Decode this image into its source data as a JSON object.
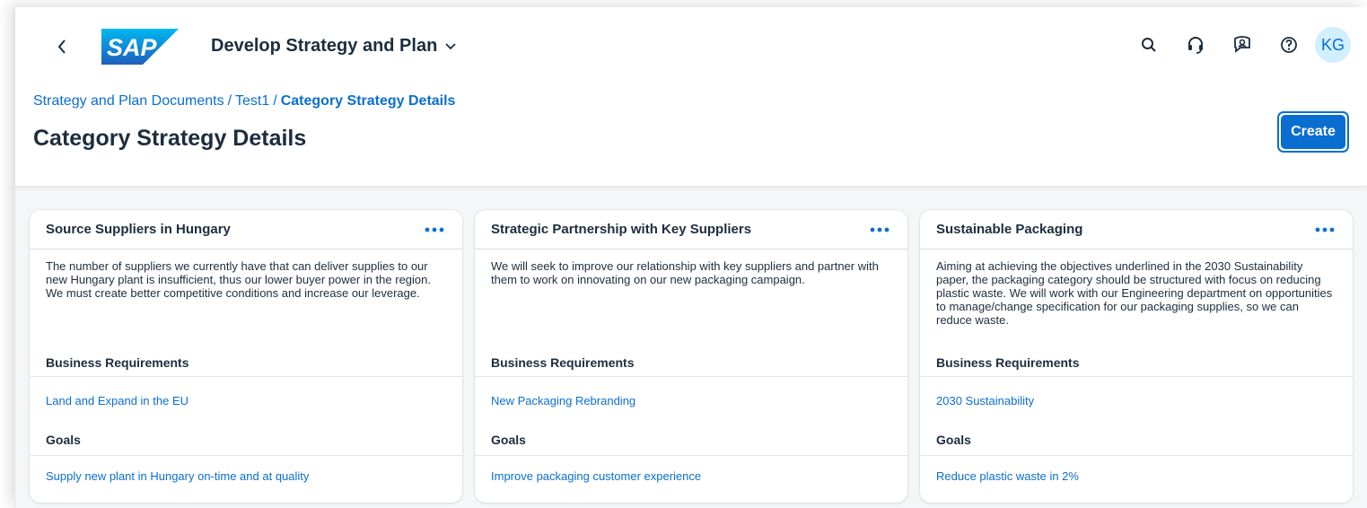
{
  "shell": {
    "app_title": "Develop Strategy and Plan",
    "avatar_initials": "KG",
    "logo_text": "SAP",
    "brand_color": "#0a6ed1"
  },
  "breadcrumb": {
    "items": [
      "Strategy and Plan Documents",
      "Test1"
    ],
    "current": "Category Strategy Details",
    "separator": "/"
  },
  "page": {
    "title": "Category Strategy Details",
    "create_label": "Create"
  },
  "cards": [
    {
      "title": "Source Suppliers in Hungary",
      "description": "The number of suppliers we currently have that can deliver supplies to our new Hungary plant is insufficient, thus our lower buyer power in the region. We must create better competitive conditions and increase our leverage.",
      "business_requirements_label": "Business Requirements",
      "business_requirement": "Land and Expand in the EU",
      "goals_label": "Goals",
      "goal": "Supply new plant in Hungary on-time and at quality"
    },
    {
      "title": "Strategic Partnership with Key Suppliers",
      "description": "We will seek to improve our relationship with key suppliers and partner with them to work on innovating on our new packaging campaign.",
      "business_requirements_label": "Business Requirements",
      "business_requirement": "New Packaging Rebranding",
      "goals_label": "Goals",
      "goal": "Improve packaging customer experience"
    },
    {
      "title": "Sustainable Packaging",
      "description": "Aiming at achieving the objectives underlined in the 2030 Sustainability paper, the packaging category should be structured with focus on reducing plastic waste. We will work with our Engineering department on opportunities to manage/change specification for our packaging supplies, so we can reduce waste.",
      "business_requirements_label": "Business Requirements",
      "business_requirement": "2030 Sustainability",
      "goals_label": "Goals",
      "goal": "Reduce plastic waste in 2%"
    }
  ]
}
